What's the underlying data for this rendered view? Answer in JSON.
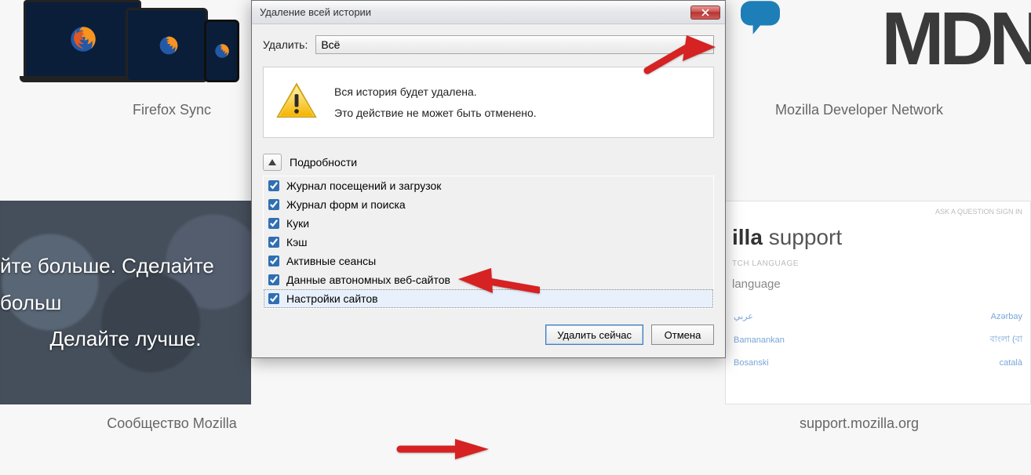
{
  "background": {
    "tiles": {
      "sync_label": "Firefox Sync",
      "mdn_label": "Mozilla Developer Network"
    },
    "hero_line1": "йте больше. Сделайте больш",
    "hero_line2": "Делайте лучше.",
    "community_label": "Сообщество Mozilla",
    "support_label": "support.mozilla.org",
    "mdn_text": "MDN",
    "support_panel": {
      "topbar": "ASK A QUESTION    SIGN IN",
      "title_pre": "illa",
      "title_post": " support",
      "sub": "TCH LANGUAGE",
      "lang": "language",
      "rows": [
        {
          "a": "عربي",
          "b": "Azərbay"
        },
        {
          "a": "Bamanankan",
          "b": "বাংলা (বা"
        },
        {
          "a": "Bosanski",
          "b": "català"
        }
      ]
    }
  },
  "dialog": {
    "title": "Удаление всей истории",
    "delete_label": "Удалить:",
    "combo_value": "Всё",
    "warn_line1": "Вся история будет удалена.",
    "warn_line2": "Это действие не может быть отменено.",
    "details_label": "Подробности",
    "items": [
      "Журнал посещений и загрузок",
      "Журнал форм и поиска",
      "Куки",
      "Кэш",
      "Активные сеансы",
      "Данные автономных веб-сайтов",
      "Настройки сайтов"
    ],
    "primary_btn": "Удалить сейчас",
    "cancel_btn": "Отмена"
  }
}
